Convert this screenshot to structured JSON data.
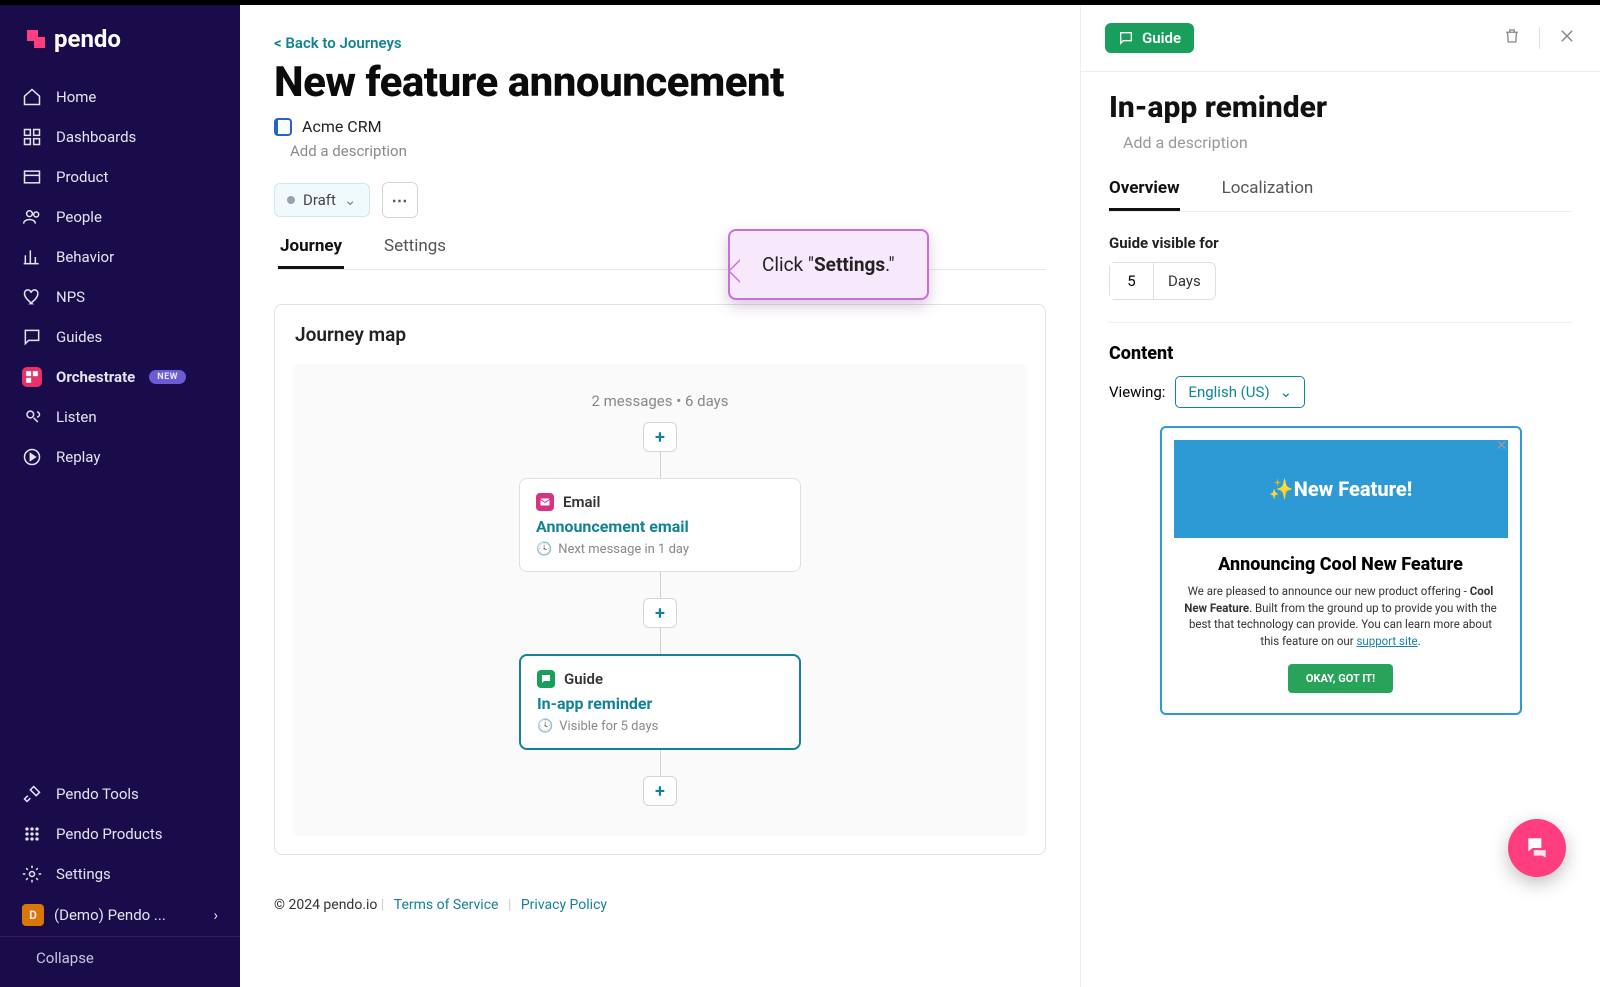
{
  "brand": "pendo",
  "sidebar": {
    "items": [
      {
        "label": "Home"
      },
      {
        "label": "Dashboards"
      },
      {
        "label": "Product"
      },
      {
        "label": "People"
      },
      {
        "label": "Behavior"
      },
      {
        "label": "NPS"
      },
      {
        "label": "Guides"
      },
      {
        "label": "Orchestrate",
        "badge": "NEW",
        "active": true
      },
      {
        "label": "Listen"
      },
      {
        "label": "Replay"
      }
    ],
    "bottom": [
      {
        "label": "Pendo Tools"
      },
      {
        "label": "Pendo Products"
      },
      {
        "label": "Settings"
      }
    ],
    "workspace": {
      "initial": "D",
      "name": "(Demo) Pendo ..."
    },
    "collapse": "Collapse"
  },
  "center": {
    "back": "< Back to Journeys",
    "title": "New feature announcement",
    "app": "Acme CRM",
    "desc_placeholder": "Add a description",
    "status": "Draft",
    "tabs": [
      "Journey",
      "Settings"
    ],
    "active_tab": "Journey",
    "tooltip": {
      "prefix": "Click \"",
      "bold": "Settings",
      "suffix": ".\""
    },
    "journey": {
      "heading": "Journey map",
      "summary": "2 messages • 6 days",
      "steps": [
        {
          "type": "Email",
          "title": "Announcement email",
          "meta": "Next message in 1 day"
        },
        {
          "type": "Guide",
          "title": "In-app reminder",
          "meta": "Visible for 5 days",
          "active": true
        }
      ]
    },
    "footer": {
      "copyright": "© 2024 pendo.io",
      "tos": "Terms of Service",
      "privacy": "Privacy Policy"
    }
  },
  "right": {
    "badge": "Guide",
    "title": "In-app reminder",
    "desc_placeholder": "Add a description",
    "tabs": [
      "Overview",
      "Localization"
    ],
    "active_tab": "Overview",
    "visible_label": "Guide visible for",
    "visible_value": "5",
    "visible_unit": "Days",
    "content": {
      "heading": "Content",
      "viewing_label": "Viewing:",
      "language": "English (US)"
    },
    "preview": {
      "hero": "✨New Feature!",
      "title": "Announcing Cool New Feature",
      "body_pre": "We are pleased to announce our new product offering - ",
      "body_bold": "Cool New Feature",
      "body_post": ". Built from the ground up to provide you with the best that technology can provide. You can learn more about this feature on our ",
      "link": "support site",
      "body_end": ".",
      "cta": "OKAY, GOT IT!"
    }
  }
}
